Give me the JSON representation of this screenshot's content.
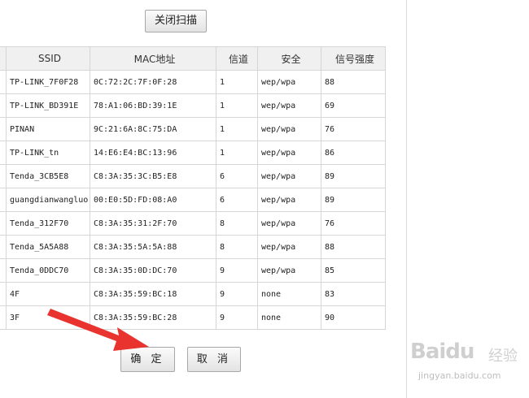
{
  "buttons": {
    "scan_close": "关闭扫描",
    "confirm": "确 定",
    "cancel": "取 消"
  },
  "table": {
    "headers": [
      "",
      "SSID",
      "MAC地址",
      "信道",
      "安全",
      "信号强度"
    ],
    "rows": [
      {
        "ssid": "TP-LINK_7F0F28",
        "mac": "0C:72:2C:7F:0F:28",
        "channel": "1",
        "security": "wep/wpa",
        "signal": "88"
      },
      {
        "ssid": "TP-LINK_BD391E",
        "mac": "78:A1:06:BD:39:1E",
        "channel": "1",
        "security": "wep/wpa",
        "signal": "69"
      },
      {
        "ssid": "PINAN",
        "mac": "9C:21:6A:8C:75:DA",
        "channel": "1",
        "security": "wep/wpa",
        "signal": "76"
      },
      {
        "ssid": "TP-LINK_tn",
        "mac": "14:E6:E4:BC:13:96",
        "channel": "1",
        "security": "wep/wpa",
        "signal": "86"
      },
      {
        "ssid": "Tenda_3CB5E8",
        "mac": "C8:3A:35:3C:B5:E8",
        "channel": "6",
        "security": "wep/wpa",
        "signal": "89"
      },
      {
        "ssid": "guangdianwangluo",
        "mac": "00:E0:5D:FD:08:A0",
        "channel": "6",
        "security": "wep/wpa",
        "signal": "89"
      },
      {
        "ssid": "Tenda_312F70",
        "mac": "C8:3A:35:31:2F:70",
        "channel": "8",
        "security": "wep/wpa",
        "signal": "76"
      },
      {
        "ssid": "Tenda_5A5A88",
        "mac": "C8:3A:35:5A:5A:88",
        "channel": "8",
        "security": "wep/wpa",
        "signal": "88"
      },
      {
        "ssid": "Tenda_0DDC70",
        "mac": "C8:3A:35:0D:DC:70",
        "channel": "9",
        "security": "wep/wpa",
        "signal": "85"
      },
      {
        "ssid": "4F",
        "mac": "C8:3A:35:59:BC:18",
        "channel": "9",
        "security": "none",
        "signal": "83"
      },
      {
        "ssid": "3F",
        "mac": "C8:3A:35:59:BC:28",
        "channel": "9",
        "security": "none",
        "signal": "90"
      }
    ]
  },
  "annotation": {
    "arrow_color": "#e8332f"
  },
  "watermark": {
    "logo": "Baidu",
    "cn": "经验",
    "url": "jingyan.baidu.com"
  }
}
